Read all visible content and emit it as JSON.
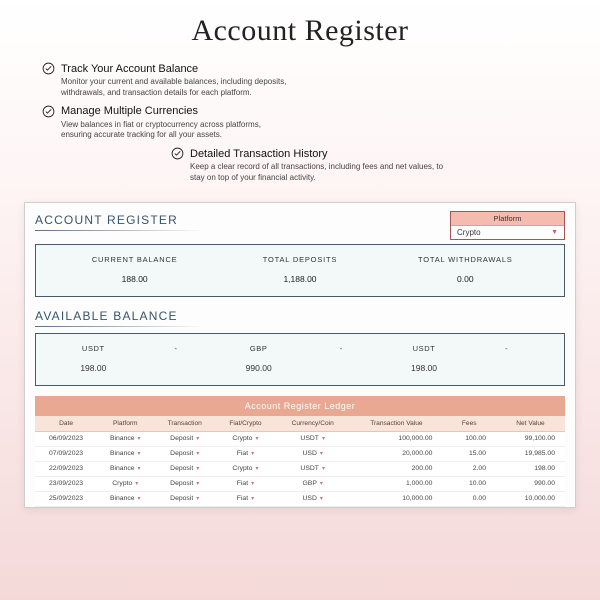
{
  "title": "Account Register",
  "features": [
    {
      "title": "Track Your Account Balance",
      "body": "Monitor your current and available balances, including deposits, withdrawals, and transaction details for each platform."
    },
    {
      "title": "Manage Multiple Currencies",
      "body": "View balances in fiat or cryptocurrency across platforms, ensuring accurate tracking for all your assets."
    },
    {
      "title": "Detailed Transaction History",
      "body": "Keep a clear record of all transactions, including fees and net values, to stay on top of your financial activity."
    }
  ],
  "sheet": {
    "section_title": "ACCOUNT REGISTER",
    "platform": {
      "label": "Platform",
      "value": "Crypto"
    },
    "kpis": [
      {
        "label": "CURRENT BALANCE",
        "value": "188.00"
      },
      {
        "label": "TOTAL DEPOSITS",
        "value": "1,188.00"
      },
      {
        "label": "TOTAL WITHDRAWALS",
        "value": "0.00"
      }
    ],
    "avail_title": "AVAILABLE BALANCE",
    "avail_cols": [
      {
        "h": "USDT",
        "v": "198.00"
      },
      {
        "h": "-",
        "v": ""
      },
      {
        "h": "GBP",
        "v": "990.00"
      },
      {
        "h": "-",
        "v": ""
      },
      {
        "h": "USDT",
        "v": "198.00"
      },
      {
        "h": "-",
        "v": ""
      }
    ],
    "ledger_title": "Account Register Ledger",
    "ledger_headers": [
      "Date",
      "Platform",
      "Transaction",
      "Fiat/Crypto",
      "Currency/Coin",
      "Transaction Value",
      "Fees",
      "Net Value"
    ],
    "ledger_rows": [
      {
        "date": "06/09/2023",
        "platform": "Binance",
        "txn": "Deposit",
        "fc": "Crypto",
        "coin": "USDT",
        "tv": "100,000.00",
        "fees": "100.00",
        "net": "99,100.00"
      },
      {
        "date": "07/09/2023",
        "platform": "Binance",
        "txn": "Deposit",
        "fc": "Fiat",
        "coin": "USD",
        "tv": "20,000.00",
        "fees": "15.00",
        "net": "19,985.00"
      },
      {
        "date": "22/09/2023",
        "platform": "Binance",
        "txn": "Deposit",
        "fc": "Crypto",
        "coin": "USDT",
        "tv": "200.00",
        "fees": "2.00",
        "net": "198.00"
      },
      {
        "date": "23/09/2023",
        "platform": "Crypto",
        "txn": "Deposit",
        "fc": "Fiat",
        "coin": "GBP",
        "tv": "1,000.00",
        "fees": "10.00",
        "net": "990.00"
      },
      {
        "date": "25/09/2023",
        "platform": "Binance",
        "txn": "Deposit",
        "fc": "Fiat",
        "coin": "USD",
        "tv": "10,000.00",
        "fees": "0.00",
        "net": "10,000.00"
      }
    ]
  }
}
